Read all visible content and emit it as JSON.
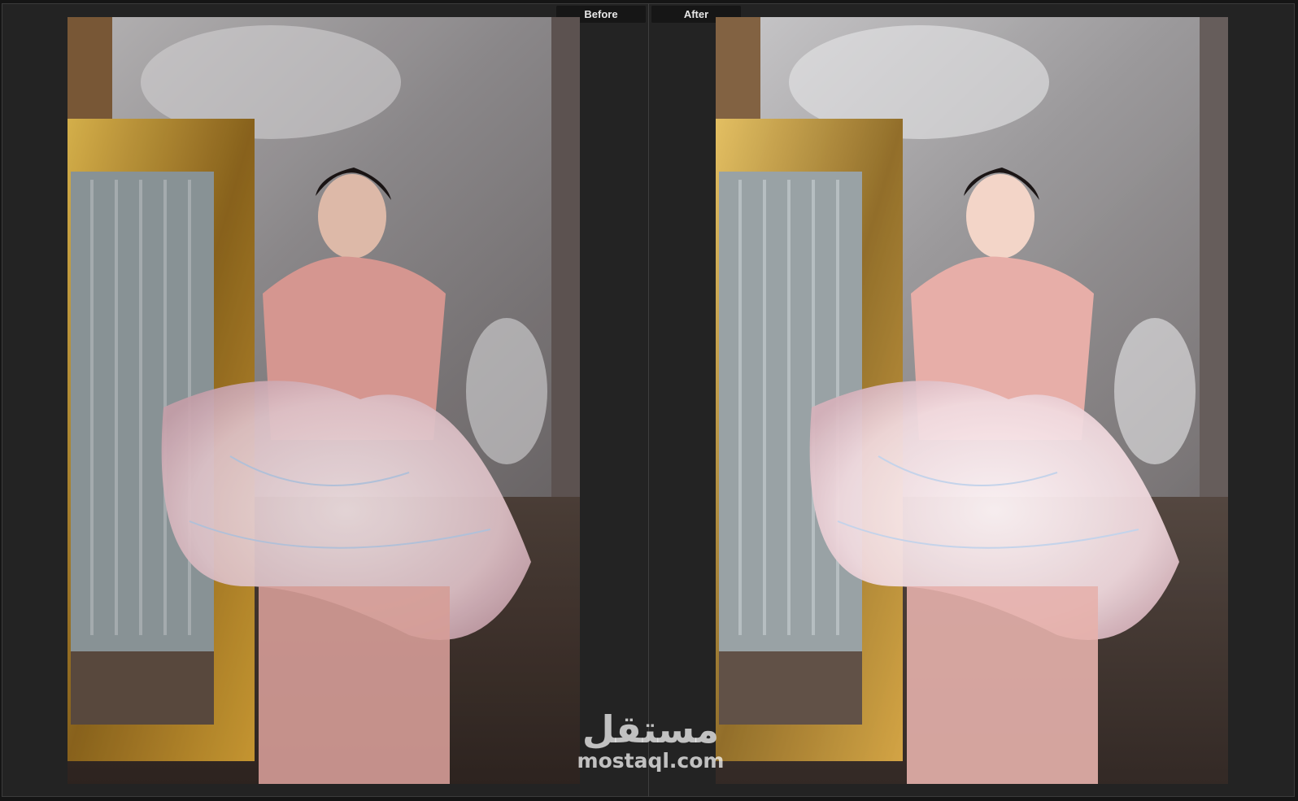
{
  "compare": {
    "before_label": "Before",
    "after_label": "After"
  },
  "watermark": {
    "arabic": "مستقل",
    "latin": "mostaql.com"
  },
  "colors": {
    "background": "#232323",
    "label_bg": "#161616",
    "label_text": "#e8e8e8",
    "dress": "#e9a9a0",
    "frame_gold": "#b8892c"
  },
  "icons": {
    "photo": "photo-portrait"
  }
}
